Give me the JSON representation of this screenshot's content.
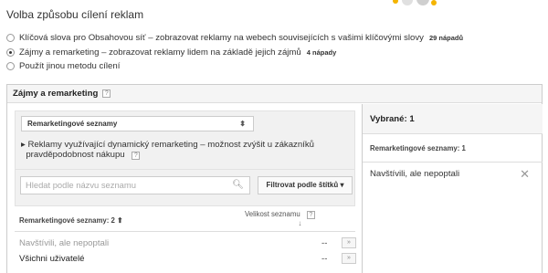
{
  "heading": "Volba způsobu cílení reklam",
  "options": [
    {
      "label": "Klíčová slova pro Obsahovou síť",
      "desc": "– zobrazovat reklamy na webech souvisejících s vašimi klíčovými slovy",
      "count": "29 nápadů",
      "selected": false
    },
    {
      "label": "Zájmy a remarketing",
      "desc": "– zobrazovat reklamy lidem na základě jejich zájmů",
      "count": "4 nápady",
      "selected": true
    },
    {
      "label": "Použít jinou metodu cílení",
      "desc": "",
      "count": "",
      "selected": false
    }
  ],
  "panel": {
    "title": "Zájmy a remarketing",
    "help": "?",
    "dropdown_value": "Remarketingové seznamy",
    "dropdown_arrow": "⬍",
    "dynamic_text_line1": "▸ Reklamy využívající dynamický remarketing – možnost zvýšit u zákazníků",
    "dynamic_text_line2": "pravděpodobnost nákupu",
    "search_placeholder": "Hledat podle názvu seznamu",
    "filter_label": "Filtrovat podle štítků",
    "filter_arrow": "▾",
    "list_header_name": "Remarketingové seznamy: 2 ⬆",
    "list_header_size": "Velikost seznamu",
    "list_header_arrow": "↓",
    "rows": [
      {
        "name": "Navštívili, ale nepoptali",
        "size": "--",
        "add": "»",
        "disabled": true
      },
      {
        "name": "Všichni uživatelé",
        "size": "--",
        "add": "»",
        "disabled": false
      }
    ]
  },
  "selected_panel": {
    "title": "Vybrané: 1",
    "subheading": "Remarketingové seznamy: 1",
    "item": "Navštívili, ale nepoptali",
    "remove": "✕"
  },
  "colors": {
    "deco_yellow": "#f4b400",
    "deco_gray": "#cfcfcf"
  }
}
